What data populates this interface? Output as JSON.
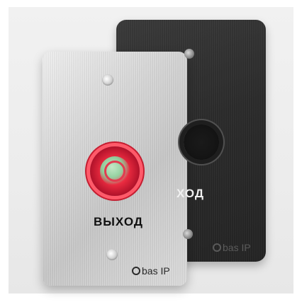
{
  "colors": {
    "background": "#ececec",
    "silver_panel": "#d6d6d6",
    "dark_panel": "#2b2b2b",
    "red_button": "#e82a3f",
    "label_dark": "#111111",
    "label_light": "#f1f1f1"
  },
  "silver_panel": {
    "label": "ВЫХОД",
    "logo_text": "bas IP",
    "button_icon": "exit-button-red-icon"
  },
  "dark_panel": {
    "label": "ХОД",
    "logo_text": "bas IP",
    "button_icon": "exit-button-black-icon"
  }
}
